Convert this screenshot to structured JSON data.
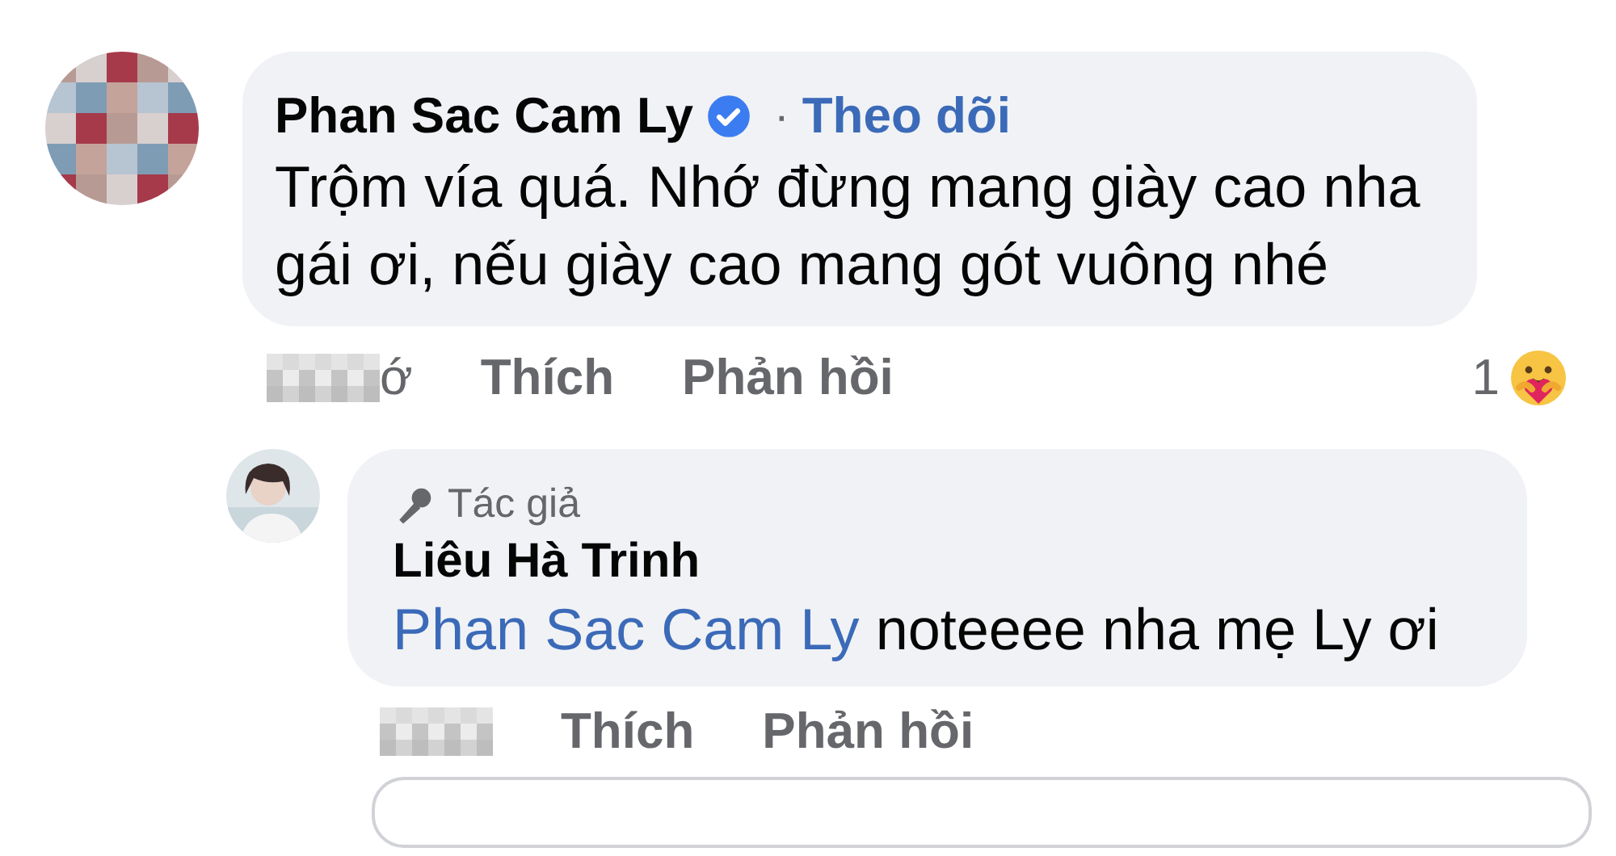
{
  "comment": {
    "author": "Phan Sac Cam Ly",
    "verified": true,
    "separator": "·",
    "follow": "Theo dõi",
    "text": "Trộm vía quá. Nhớ đừng mang giày cao nha gái ơi, nếu giày cao mang gót vuông nhé",
    "time_visible": "ớ",
    "actions": [
      "Thích",
      "Phản hồi"
    ],
    "reaction_count": "1",
    "replies": [
      {
        "badge": "Tác giả",
        "author": "Liêu Hà Trinh",
        "mention": "Phan Sac Cam Ly",
        "text": "noteeee nha mẹ Ly ơi",
        "actions": [
          "Thích",
          "Phản hồi"
        ]
      }
    ]
  }
}
